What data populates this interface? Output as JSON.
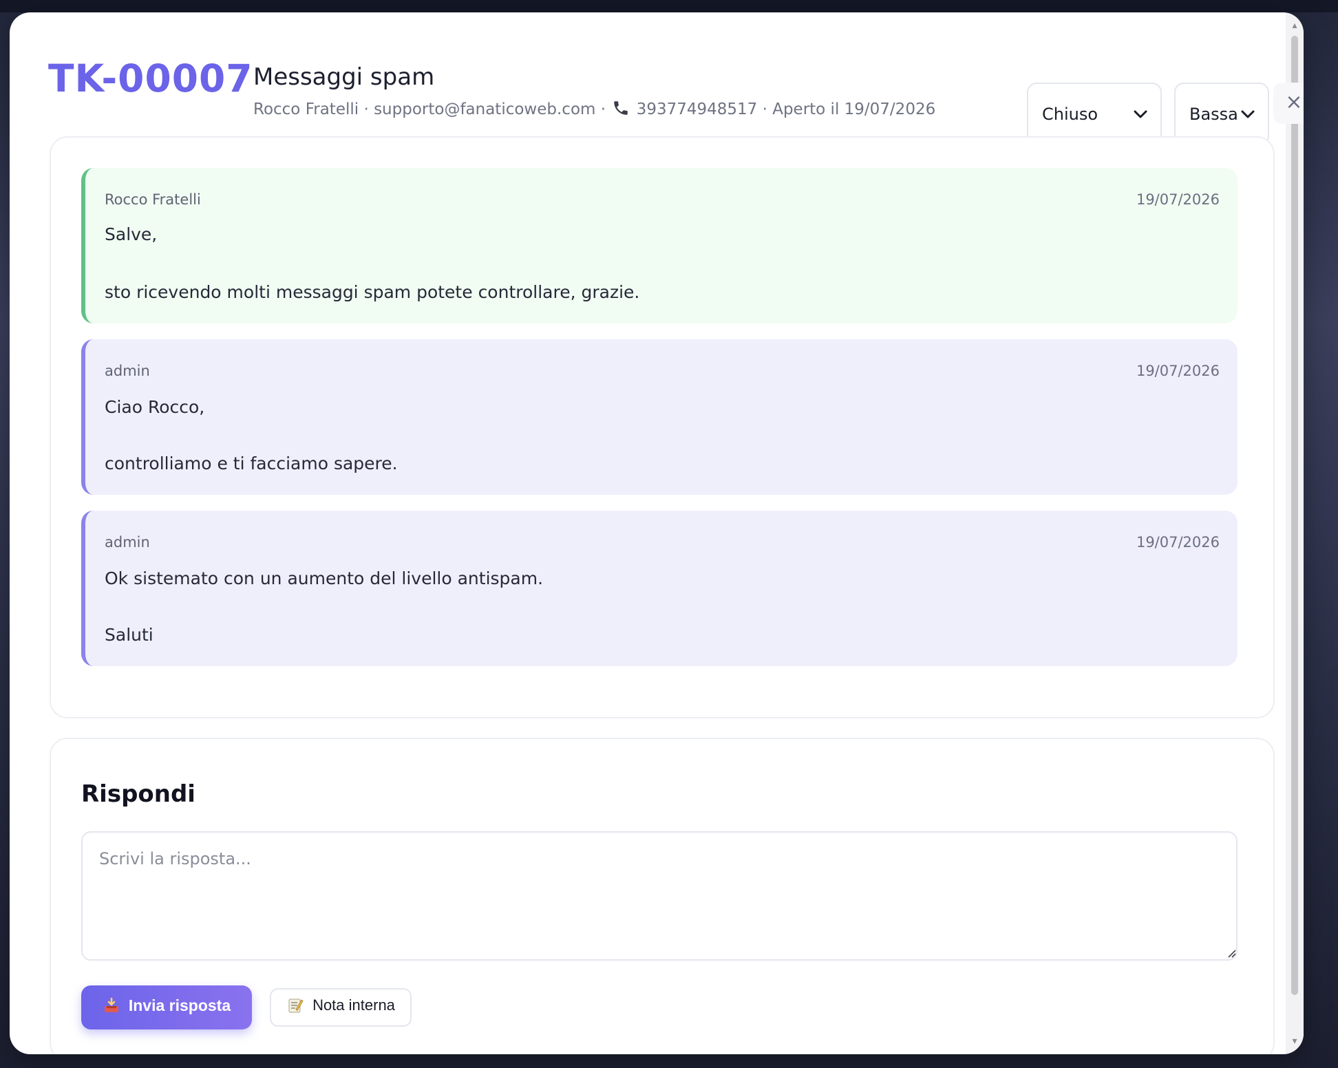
{
  "ticket": {
    "id": "TK-00007",
    "title": "Messaggi spam",
    "meta_customer": "Rocco Fratelli · supporto@fanaticoweb.com · ",
    "meta_phone": " 393774948517 · Aperto il 19/07/2026",
    "status": "Chiuso",
    "priority": "Bassa",
    "close_label": "×"
  },
  "messages": [
    {
      "author": "Rocco Fratelli",
      "date": "19/07/2026",
      "type": "customer",
      "lines": [
        "Salve,",
        "sto ricevendo molti messaggi spam potete controllare, grazie."
      ]
    },
    {
      "author": "admin",
      "date": "19/07/2026",
      "type": "agent",
      "lines": [
        "Ciao Rocco,",
        "controlliamo e ti facciamo sapere."
      ]
    },
    {
      "author": "admin",
      "date": "19/07/2026",
      "type": "agent",
      "lines": [
        "Ok sistemato con un aumento del livello antispam.",
        "Saluti"
      ]
    }
  ],
  "reply": {
    "title": "Rispondi",
    "placeholder": "Scrivi la risposta...",
    "send_label": "Invia risposta",
    "note_label": "Nota interna"
  },
  "icons": {
    "phone": "phone-icon",
    "send": "inbox-tray-icon",
    "note": "memo-icon"
  },
  "colors": {
    "accent": "#6b63e8",
    "customer_border": "#5fc286",
    "agent_border": "#8b83ea"
  }
}
